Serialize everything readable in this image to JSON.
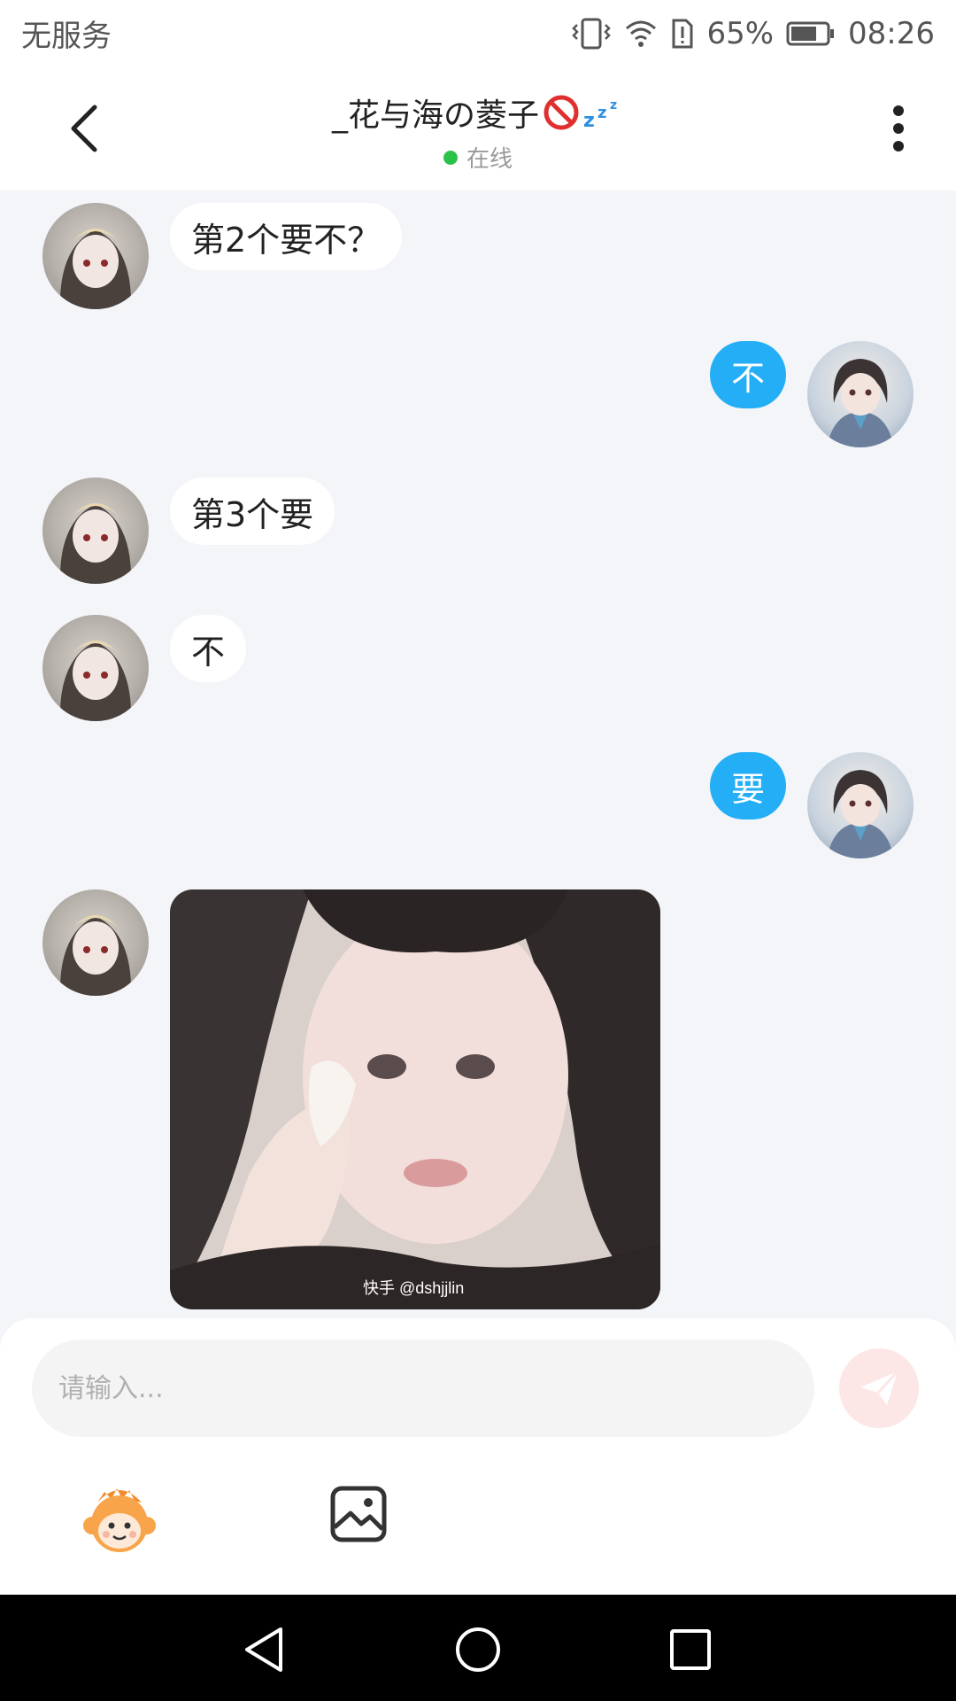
{
  "status_bar": {
    "carrier": "无服务",
    "battery": "65%",
    "time": "08:26"
  },
  "header": {
    "title": "_花与海の菱子",
    "status": "在线",
    "title_icons": [
      "no-entry-icon",
      "sleeping-zzz-icon"
    ]
  },
  "messages": [
    {
      "from": "other",
      "text": "第2个要不？"
    },
    {
      "from": "self",
      "text": "不"
    },
    {
      "from": "other",
      "text": "第3个要"
    },
    {
      "from": "other",
      "text": "不"
    },
    {
      "from": "self",
      "text": "要"
    },
    {
      "from": "other",
      "type": "image",
      "watermark": "快手 @dshjjlin"
    }
  ],
  "input": {
    "placeholder": "请输入..."
  },
  "colors": {
    "self_bubble": "#23aef6",
    "other_bubble": "#ffffff",
    "chat_background": "#f3f5f8",
    "online_dot": "#2cc24a",
    "send_button": "#fde6e6"
  }
}
